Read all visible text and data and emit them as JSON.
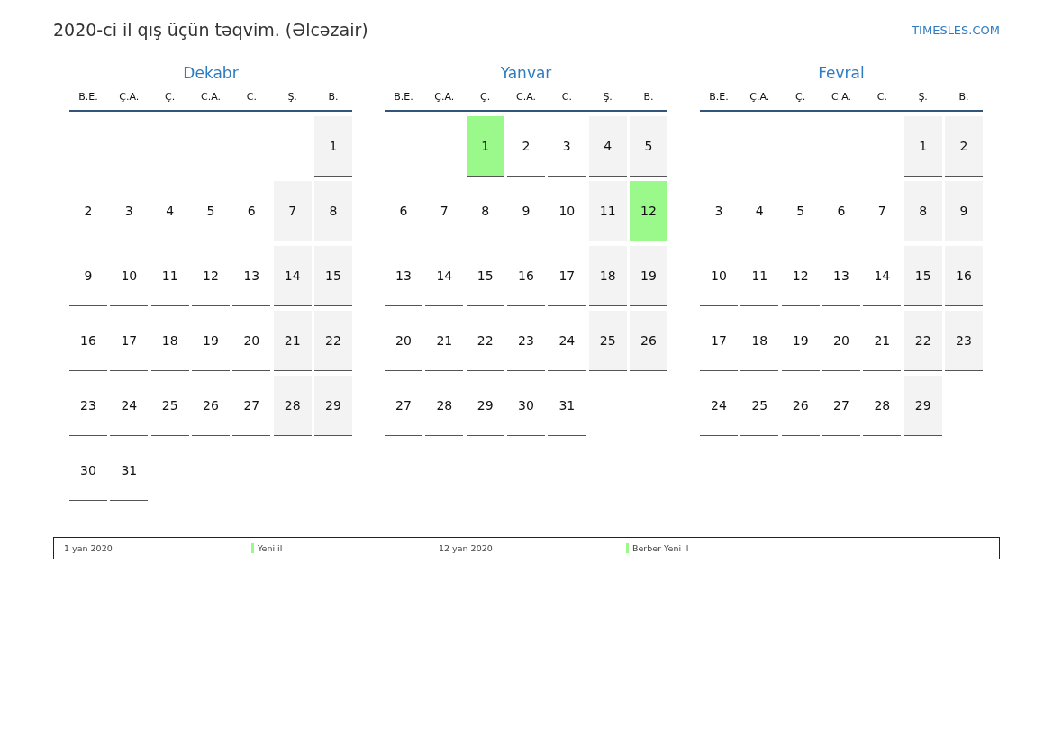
{
  "title": "2020-ci il qış üçün təqvim. (Əlcəzair)",
  "site": "TIMESLES.COM",
  "months": [
    {
      "name": "Dekabr",
      "weekdays": [
        "B.E.",
        "Ç.A.",
        "Ç.",
        "C.A.",
        "C.",
        "Ş.",
        "B."
      ],
      "weeks": [
        [
          {
            "day": "1",
            "weekend": true,
            "holiday": false
          }
        ],
        [
          {
            "day": "2",
            "weekend": false,
            "holiday": false
          },
          {
            "day": "3",
            "weekend": false,
            "holiday": false
          },
          {
            "day": "4",
            "weekend": false,
            "holiday": false
          },
          {
            "day": "5",
            "weekend": false,
            "holiday": false
          },
          {
            "day": "6",
            "weekend": false,
            "holiday": false
          },
          {
            "day": "7",
            "weekend": true,
            "holiday": false
          },
          {
            "day": "8",
            "weekend": true,
            "holiday": false
          }
        ],
        [
          {
            "day": "9",
            "weekend": false,
            "holiday": false
          },
          {
            "day": "10",
            "weekend": false,
            "holiday": false
          },
          {
            "day": "11",
            "weekend": false,
            "holiday": false
          },
          {
            "day": "12",
            "weekend": false,
            "holiday": false
          },
          {
            "day": "13",
            "weekend": false,
            "holiday": false
          },
          {
            "day": "14",
            "weekend": true,
            "holiday": false
          },
          {
            "day": "15",
            "weekend": true,
            "holiday": false
          }
        ],
        [
          {
            "day": "16",
            "weekend": false,
            "holiday": false
          },
          {
            "day": "17",
            "weekend": false,
            "holiday": false
          },
          {
            "day": "18",
            "weekend": false,
            "holiday": false
          },
          {
            "day": "19",
            "weekend": false,
            "holiday": false
          },
          {
            "day": "20",
            "weekend": false,
            "holiday": false
          },
          {
            "day": "21",
            "weekend": true,
            "holiday": false
          },
          {
            "day": "22",
            "weekend": true,
            "holiday": false
          }
        ],
        [
          {
            "day": "23",
            "weekend": false,
            "holiday": false
          },
          {
            "day": "24",
            "weekend": false,
            "holiday": false
          },
          {
            "day": "25",
            "weekend": false,
            "holiday": false
          },
          {
            "day": "26",
            "weekend": false,
            "holiday": false
          },
          {
            "day": "27",
            "weekend": false,
            "holiday": false
          },
          {
            "day": "28",
            "weekend": true,
            "holiday": false
          },
          {
            "day": "29",
            "weekend": true,
            "holiday": false
          }
        ],
        [
          {
            "day": "30",
            "weekend": false,
            "holiday": false
          },
          {
            "day": "31",
            "weekend": false,
            "holiday": false
          }
        ]
      ]
    },
    {
      "name": "Yanvar",
      "weekdays": [
        "B.E.",
        "Ç.A.",
        "Ç.",
        "C.A.",
        "C.",
        "Ş.",
        "B."
      ],
      "weeks": [
        [
          {
            "day": "1",
            "weekend": false,
            "holiday": true
          },
          {
            "day": "2",
            "weekend": false,
            "holiday": false
          },
          {
            "day": "3",
            "weekend": false,
            "holiday": false
          },
          {
            "day": "4",
            "weekend": true,
            "holiday": false
          },
          {
            "day": "5",
            "weekend": true,
            "holiday": false
          }
        ],
        [
          {
            "day": "6",
            "weekend": false,
            "holiday": false
          },
          {
            "day": "7",
            "weekend": false,
            "holiday": false
          },
          {
            "day": "8",
            "weekend": false,
            "holiday": false
          },
          {
            "day": "9",
            "weekend": false,
            "holiday": false
          },
          {
            "day": "10",
            "weekend": false,
            "holiday": false
          },
          {
            "day": "11",
            "weekend": true,
            "holiday": false
          },
          {
            "day": "12",
            "weekend": true,
            "holiday": true
          }
        ],
        [
          {
            "day": "13",
            "weekend": false,
            "holiday": false
          },
          {
            "day": "14",
            "weekend": false,
            "holiday": false
          },
          {
            "day": "15",
            "weekend": false,
            "holiday": false
          },
          {
            "day": "16",
            "weekend": false,
            "holiday": false
          },
          {
            "day": "17",
            "weekend": false,
            "holiday": false
          },
          {
            "day": "18",
            "weekend": true,
            "holiday": false
          },
          {
            "day": "19",
            "weekend": true,
            "holiday": false
          }
        ],
        [
          {
            "day": "20",
            "weekend": false,
            "holiday": false
          },
          {
            "day": "21",
            "weekend": false,
            "holiday": false
          },
          {
            "day": "22",
            "weekend": false,
            "holiday": false
          },
          {
            "day": "23",
            "weekend": false,
            "holiday": false
          },
          {
            "day": "24",
            "weekend": false,
            "holiday": false
          },
          {
            "day": "25",
            "weekend": true,
            "holiday": false
          },
          {
            "day": "26",
            "weekend": true,
            "holiday": false
          }
        ],
        [
          {
            "day": "27",
            "weekend": false,
            "holiday": false
          },
          {
            "day": "28",
            "weekend": false,
            "holiday": false
          },
          {
            "day": "29",
            "weekend": false,
            "holiday": false
          },
          {
            "day": "30",
            "weekend": false,
            "holiday": false
          },
          {
            "day": "31",
            "weekend": false,
            "holiday": false
          }
        ]
      ]
    },
    {
      "name": "Fevral",
      "weekdays": [
        "B.E.",
        "Ç.A.",
        "Ç.",
        "C.A.",
        "C.",
        "Ş.",
        "B."
      ],
      "weeks": [
        [
          {
            "day": "1",
            "weekend": true,
            "holiday": false
          },
          {
            "day": "2",
            "weekend": true,
            "holiday": false
          }
        ],
        [
          {
            "day": "3",
            "weekend": false,
            "holiday": false
          },
          {
            "day": "4",
            "weekend": false,
            "holiday": false
          },
          {
            "day": "5",
            "weekend": false,
            "holiday": false
          },
          {
            "day": "6",
            "weekend": false,
            "holiday": false
          },
          {
            "day": "7",
            "weekend": false,
            "holiday": false
          },
          {
            "day": "8",
            "weekend": true,
            "holiday": false
          },
          {
            "day": "9",
            "weekend": true,
            "holiday": false
          }
        ],
        [
          {
            "day": "10",
            "weekend": false,
            "holiday": false
          },
          {
            "day": "11",
            "weekend": false,
            "holiday": false
          },
          {
            "day": "12",
            "weekend": false,
            "holiday": false
          },
          {
            "day": "13",
            "weekend": false,
            "holiday": false
          },
          {
            "day": "14",
            "weekend": false,
            "holiday": false
          },
          {
            "day": "15",
            "weekend": true,
            "holiday": false
          },
          {
            "day": "16",
            "weekend": true,
            "holiday": false
          }
        ],
        [
          {
            "day": "17",
            "weekend": false,
            "holiday": false
          },
          {
            "day": "18",
            "weekend": false,
            "holiday": false
          },
          {
            "day": "19",
            "weekend": false,
            "holiday": false
          },
          {
            "day": "20",
            "weekend": false,
            "holiday": false
          },
          {
            "day": "21",
            "weekend": false,
            "holiday": false
          },
          {
            "day": "22",
            "weekend": true,
            "holiday": false
          },
          {
            "day": "23",
            "weekend": true,
            "holiday": false
          }
        ],
        [
          {
            "day": "24",
            "weekend": false,
            "holiday": false
          },
          {
            "day": "25",
            "weekend": false,
            "holiday": false
          },
          {
            "day": "26",
            "weekend": false,
            "holiday": false
          },
          {
            "day": "27",
            "weekend": false,
            "holiday": false
          },
          {
            "day": "28",
            "weekend": false,
            "holiday": false
          },
          {
            "day": "29",
            "weekend": true,
            "holiday": false
          }
        ]
      ]
    }
  ],
  "holidays": [
    {
      "date": "1 yan 2020",
      "name": "Yeni il"
    },
    {
      "date": "12 yan 2020",
      "name": "Berber Yeni il"
    }
  ]
}
